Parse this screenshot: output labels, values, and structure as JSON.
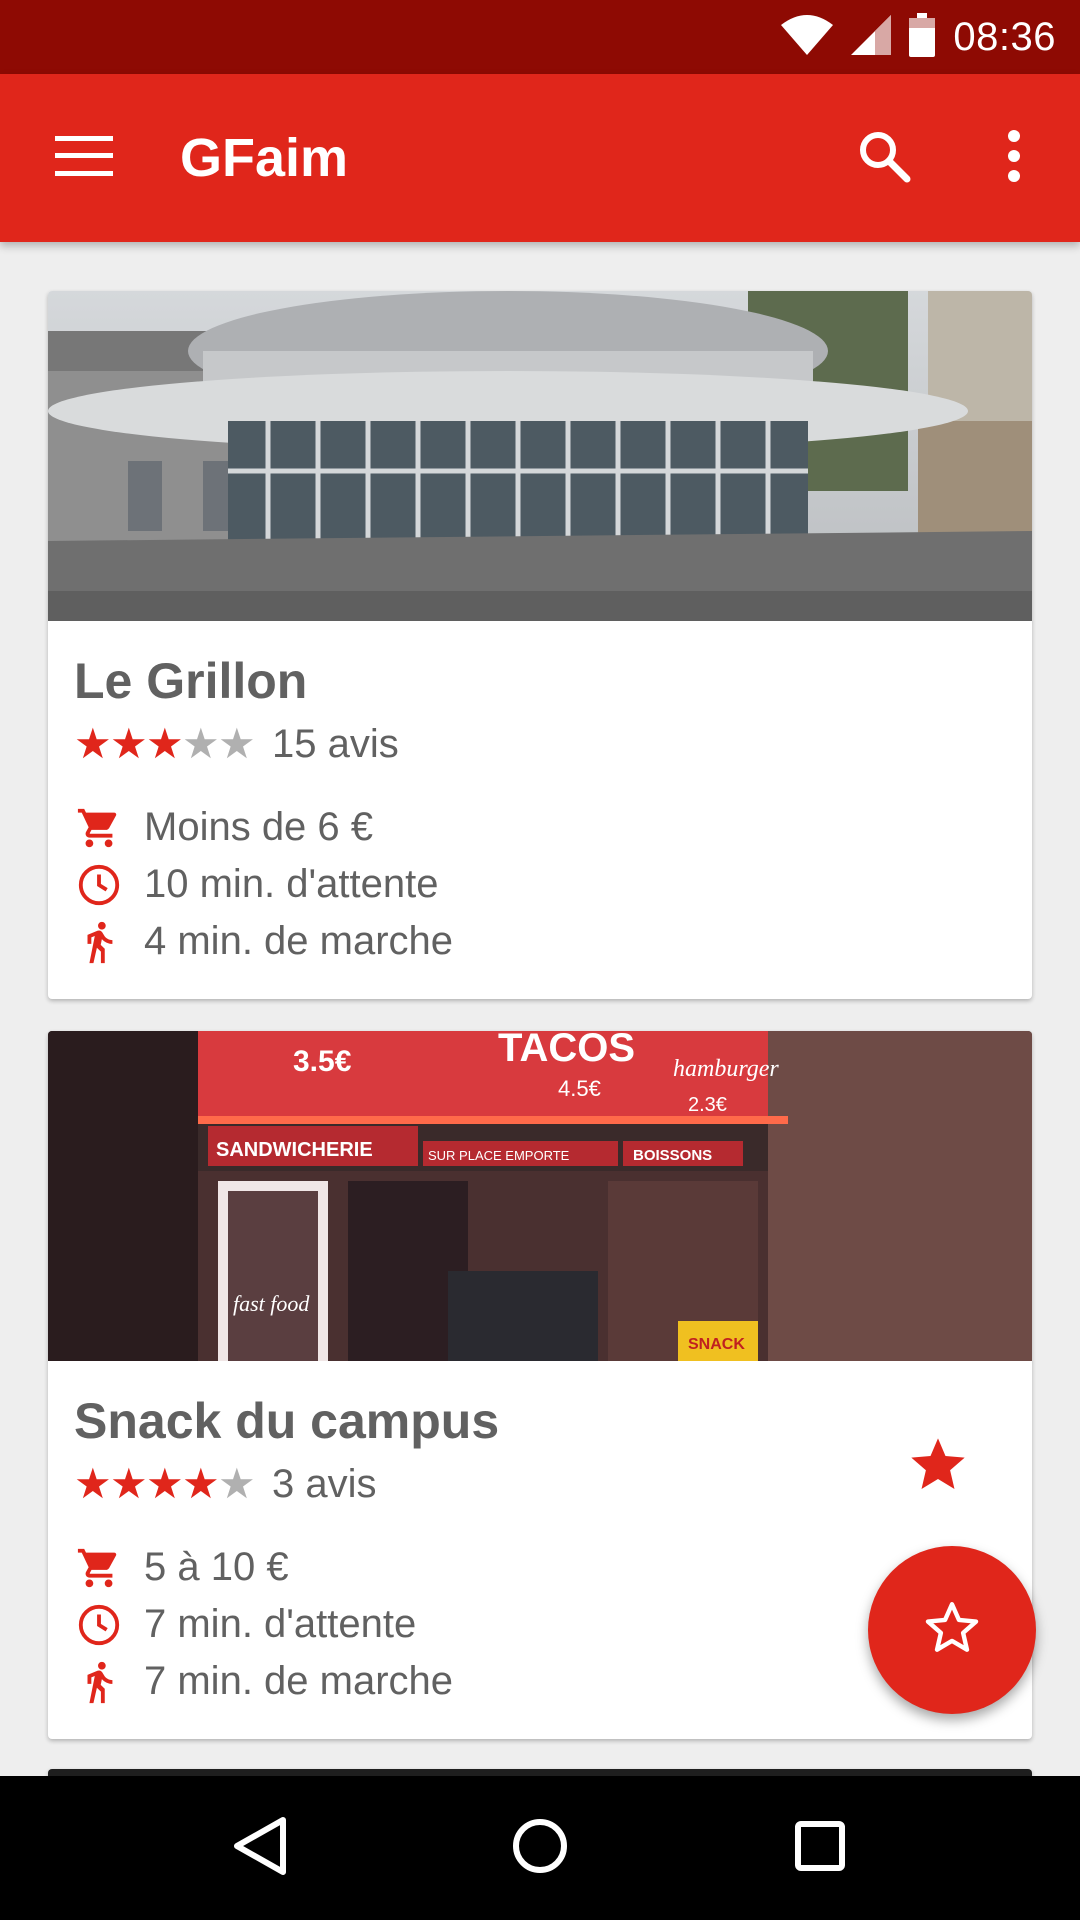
{
  "status_bar": {
    "time": "08:36"
  },
  "app_bar": {
    "title": "GFaim"
  },
  "colors": {
    "primary": "#e0261b",
    "primary_dark": "#8e0a03",
    "text": "#616161",
    "star_off": "#b0b0b0"
  },
  "cards": [
    {
      "name": "Le Grillon",
      "rating": 3,
      "rating_max": 5,
      "reviews": "15 avis",
      "price": "Moins de 6 €",
      "wait": "10 min. d'attente",
      "walk": "4 min. de marche",
      "favorite": false
    },
    {
      "name": "Snack du campus",
      "rating": 4,
      "rating_max": 5,
      "reviews": "3 avis",
      "price": "5 à 10 €",
      "wait": "7 min. d'attente",
      "walk": "7 min. de marche",
      "favorite": true
    }
  ],
  "photo_signs": {
    "card2": [
      "3.5€",
      "TACOS",
      "4.5€",
      "hamburger",
      "2.3€",
      "SANDWICHERIE",
      "SUR PLACE EMPORTE",
      "BOISSONS",
      "fast food",
      "SNACK"
    ]
  },
  "icons": {
    "menu": "menu-icon",
    "search": "search-icon",
    "overflow": "more-vert-icon",
    "price": "cart-icon",
    "wait": "clock-icon",
    "walk": "walk-icon",
    "fab": "star-outline-icon",
    "nav_back": "back-icon",
    "nav_home": "home-icon",
    "nav_recents": "recents-icon"
  }
}
